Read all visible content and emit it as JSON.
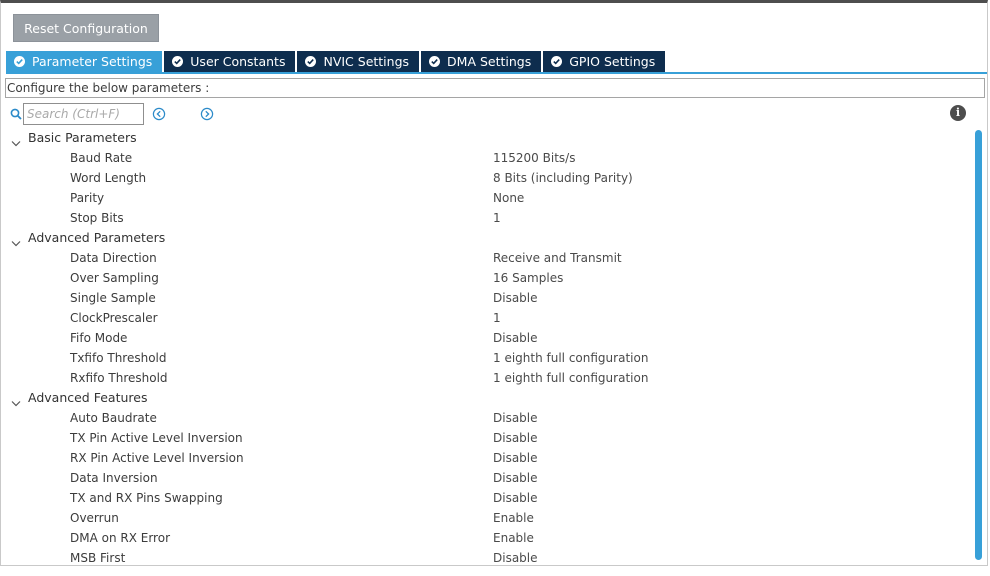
{
  "toolbar": {
    "reset_label": "Reset Configuration"
  },
  "tabs": [
    {
      "label": "Parameter Settings",
      "active": true
    },
    {
      "label": "User Constants",
      "active": false
    },
    {
      "label": "NVIC Settings",
      "active": false
    },
    {
      "label": "DMA Settings",
      "active": false
    },
    {
      "label": "GPIO Settings",
      "active": false
    }
  ],
  "configure_label": "Configure the below parameters :",
  "search": {
    "placeholder": "Search (Ctrl+F)",
    "value": ""
  },
  "icons": {
    "search": "search-icon",
    "prev": "circle-chevron-left-icon",
    "next": "circle-chevron-right-icon",
    "info": "info-icon",
    "expand": "chevron-down-icon",
    "tab_status": "check-circle-icon"
  },
  "colors": {
    "tab_active": "#38a0d8",
    "tab_inactive": "#0e2d4e",
    "button": "#9aa0a6",
    "scrollbar": "#38a0d8"
  },
  "groups": [
    {
      "label": "Basic Parameters",
      "params": [
        {
          "name": "Baud Rate",
          "value": "115200 Bits/s"
        },
        {
          "name": "Word Length",
          "value": "8 Bits (including Parity)"
        },
        {
          "name": "Parity",
          "value": "None"
        },
        {
          "name": "Stop Bits",
          "value": "1"
        }
      ]
    },
    {
      "label": "Advanced Parameters",
      "params": [
        {
          "name": "Data Direction",
          "value": "Receive and Transmit"
        },
        {
          "name": "Over Sampling",
          "value": "16 Samples"
        },
        {
          "name": "Single Sample",
          "value": "Disable"
        },
        {
          "name": "ClockPrescaler",
          "value": "1"
        },
        {
          "name": "Fifo Mode",
          "value": "Disable"
        },
        {
          "name": "Txfifo Threshold",
          "value": "1 eighth full configuration"
        },
        {
          "name": "Rxfifo Threshold",
          "value": "1 eighth full configuration"
        }
      ]
    },
    {
      "label": "Advanced Features",
      "params": [
        {
          "name": "Auto Baudrate",
          "value": "Disable"
        },
        {
          "name": "TX Pin Active Level Inversion",
          "value": "Disable"
        },
        {
          "name": "RX Pin Active Level Inversion",
          "value": "Disable"
        },
        {
          "name": "Data Inversion",
          "value": "Disable"
        },
        {
          "name": "TX and RX Pins Swapping",
          "value": "Disable"
        },
        {
          "name": "Overrun",
          "value": "Enable"
        },
        {
          "name": "DMA on RX Error",
          "value": "Enable"
        },
        {
          "name": "MSB First",
          "value": "Disable"
        }
      ]
    }
  ]
}
